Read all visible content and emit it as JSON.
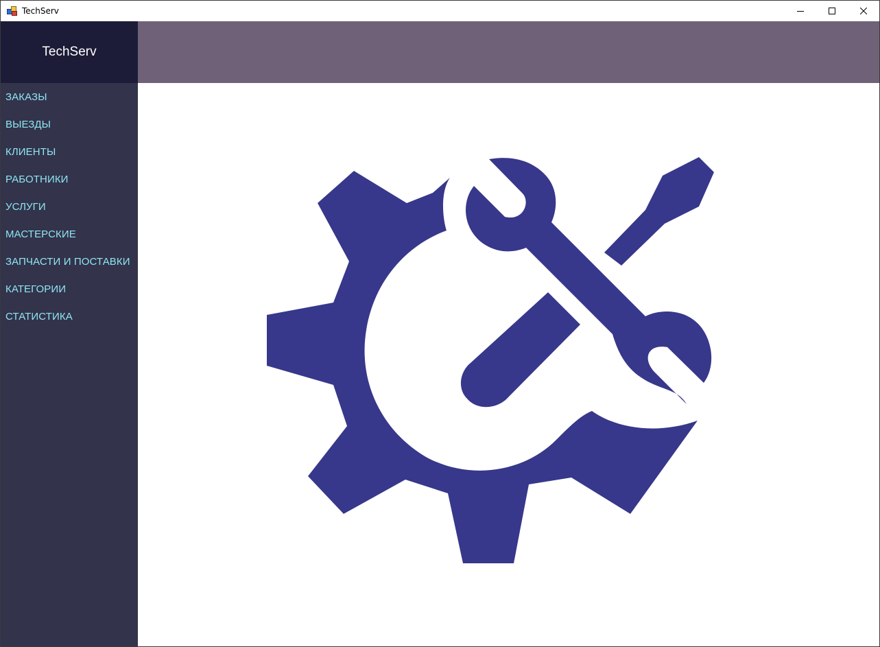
{
  "window": {
    "title": "TechServ",
    "controls": [
      "minimize-icon",
      "maximize-icon",
      "close-icon"
    ]
  },
  "sidebar": {
    "logo_text": "TechServ",
    "items": [
      {
        "label": "ЗАКАЗЫ"
      },
      {
        "label": "ВЫЕЗДЫ"
      },
      {
        "label": "КЛИЕНТЫ"
      },
      {
        "label": "РАБОТНИКИ"
      },
      {
        "label": "УСЛУГИ"
      },
      {
        "label": "МАСТЕРСКИЕ"
      },
      {
        "label": "ЗАПЧАСТИ И ПОСТАВКИ"
      },
      {
        "label": "КАТЕГОРИИ"
      },
      {
        "label": "СТАТИСТИКА"
      }
    ]
  },
  "main": {
    "image_icon": "gear-wrench-screwdriver-icon"
  },
  "colors": {
    "sidebar_bg": "#33334c",
    "logo_bg": "#1c1c38",
    "header_bg": "#6f6278",
    "menu_text": "#8fe6f0",
    "icon_fill": "#37378b"
  }
}
